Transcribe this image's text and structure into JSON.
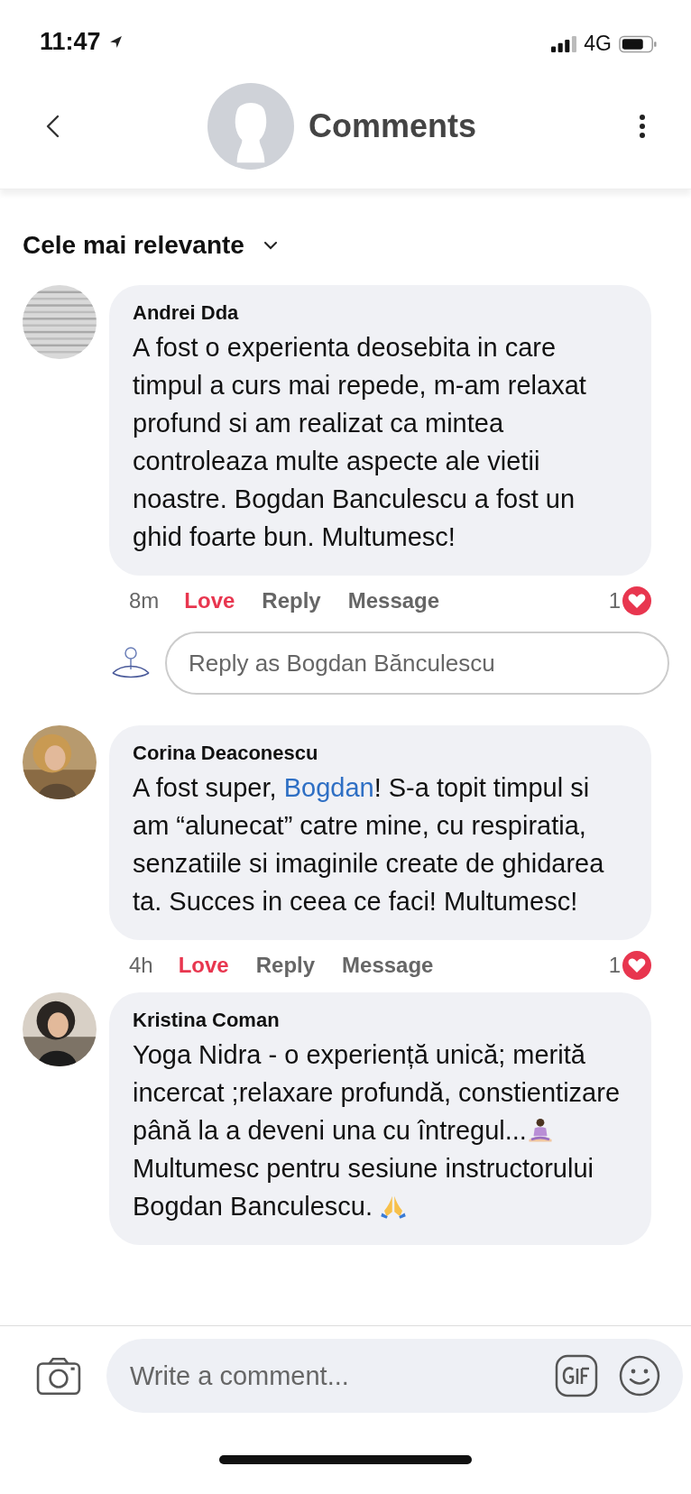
{
  "status_bar": {
    "time": "11:47",
    "network": "4G"
  },
  "header": {
    "title": "Comments"
  },
  "sort": {
    "label": "Cele mai relevante"
  },
  "comments": [
    {
      "author": "Andrei Dda",
      "body": [
        {
          "kind": "text",
          "text": "A fost o experienta deosebita in care timpul a curs mai repede, m-am relaxat profund si am realizat ca mintea controleaza multe aspecte ale vietii noastre. Bogdan Banculescu a fost un ghid foarte bun. Multumesc!"
        }
      ],
      "time": "8m",
      "love": "Love",
      "loved": true,
      "reply": "Reply",
      "message": "Message",
      "reactions": "1",
      "reply_field": {
        "placeholder": "Reply as Bogdan Bănculescu"
      }
    },
    {
      "author": "Corina Deaconescu",
      "body": [
        {
          "kind": "text",
          "text": "A fost super, "
        },
        {
          "kind": "mention",
          "text": "Bogdan"
        },
        {
          "kind": "text",
          "text": "! S-a topit timpul si am “alunecat” catre mine, cu respiratia, senzatiile si imaginile create de ghidarea ta. Succes in ceea ce faci! Multumesc!"
        }
      ],
      "time": "4h",
      "love": "Love",
      "loved": true,
      "reply": "Reply",
      "message": "Message",
      "reactions": "1"
    },
    {
      "author": "Kristina Coman",
      "body": [
        {
          "kind": "text",
          "text": "Yoga Nidra - o experiență unică; merită incercat ;relaxare profundă, constientizare până la a deveni una cu întregul..."
        },
        {
          "kind": "meditating"
        },
        {
          "kind": "text",
          "text": " Multumesc pentru sesiune instructorului Bogdan Banculescu. "
        },
        {
          "kind": "praying"
        }
      ]
    }
  ],
  "composer": {
    "placeholder": "Write a comment..."
  }
}
